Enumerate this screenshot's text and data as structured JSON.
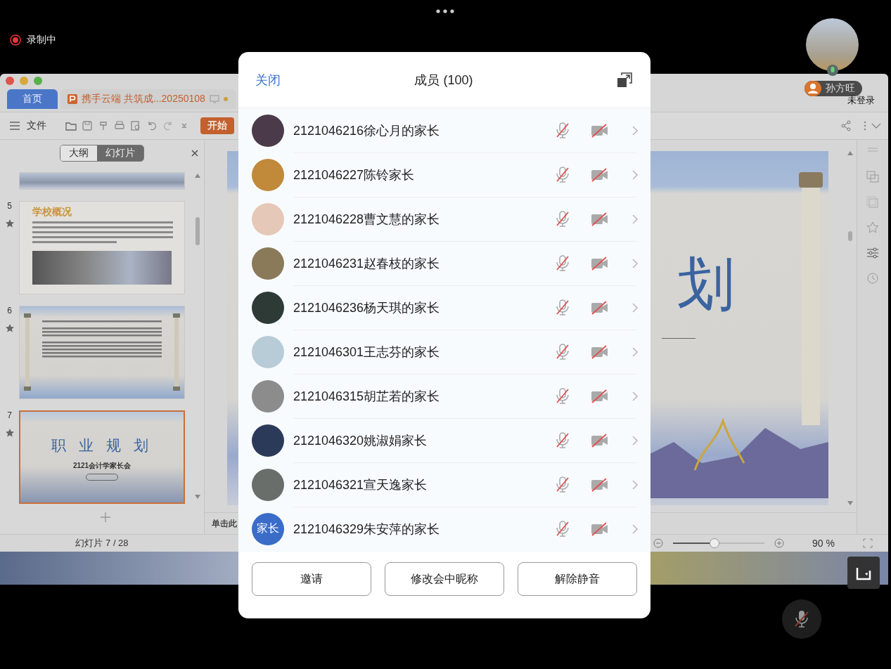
{
  "recording": {
    "label": "录制中"
  },
  "shared_window": {
    "tabs": [
      {
        "label": "首页",
        "kind": "home",
        "selected": true
      },
      {
        "label": "携手云端 共筑成...20250108",
        "kind": "document",
        "selected": false
      }
    ],
    "toolbar": {
      "menu_label": "文件",
      "start_button": "开始"
    },
    "panel_tabs": [
      {
        "label": "大纲",
        "selected": false
      },
      {
        "label": "幻灯片",
        "selected": true
      }
    ],
    "slides": [
      {
        "number": "5",
        "kind": "overview",
        "title": "学校概况",
        "selected": false
      },
      {
        "number": "6",
        "kind": "scroll_text",
        "selected": false
      },
      {
        "number": "7",
        "kind": "cover",
        "title": "职 业 规 划",
        "subtitle": "2121会计学家长会",
        "selected": true
      }
    ],
    "status": "幻灯片 7 / 28",
    "slide": {
      "title_char": "划",
      "notes_hint": "单击此"
    },
    "zoom": {
      "level": 0.45,
      "reading": "90 %"
    }
  },
  "presenter": {
    "name": "孙方旺",
    "login_status": "未登录"
  },
  "members_dialog": {
    "close": "关闭",
    "title": "成员 (100)",
    "members": [
      {
        "name": "2121046216徐心月的家长",
        "avatar": {
          "kind": "photo",
          "color": "#4a3a4a"
        },
        "mic_muted": true,
        "camera_off": true
      },
      {
        "name": "2121046227陈铃家长",
        "avatar": {
          "kind": "photo",
          "color": "#c08a3a"
        },
        "mic_muted": true,
        "camera_off": true
      },
      {
        "name": "2121046228曹文慧的家长",
        "avatar": {
          "kind": "photo",
          "color": "#e6c8b8"
        },
        "mic_muted": true,
        "camera_off": true
      },
      {
        "name": "2121046231赵春枝的家长",
        "avatar": {
          "kind": "photo",
          "color": "#8a7a5a"
        },
        "mic_muted": true,
        "camera_off": true
      },
      {
        "name": "2121046236杨天琪的家长",
        "avatar": {
          "kind": "photo",
          "color": "#2e3a36"
        },
        "mic_muted": true,
        "camera_off": true
      },
      {
        "name": "2121046301王志芬的家长",
        "avatar": {
          "kind": "photo",
          "color": "#b8ccd8"
        },
        "mic_muted": true,
        "camera_off": true
      },
      {
        "name": "2121046315胡芷若的家长",
        "avatar": {
          "kind": "photo",
          "color": "#8c8c8c"
        },
        "mic_muted": true,
        "camera_off": true
      },
      {
        "name": "2121046320姚淑娟家长",
        "avatar": {
          "kind": "photo",
          "color": "#2c3a5a"
        },
        "mic_muted": true,
        "camera_off": true
      },
      {
        "name": "2121046321宣天逸家长",
        "avatar": {
          "kind": "photo",
          "color": "#6a6e6a"
        },
        "mic_muted": true,
        "camera_off": true
      },
      {
        "name": "2121046329朱安萍的家长",
        "avatar": {
          "kind": "text",
          "text": "家长"
        },
        "mic_muted": true,
        "camera_off": true
      }
    ],
    "buttons": [
      "邀请",
      "修改会中昵称",
      "解除静音"
    ]
  }
}
